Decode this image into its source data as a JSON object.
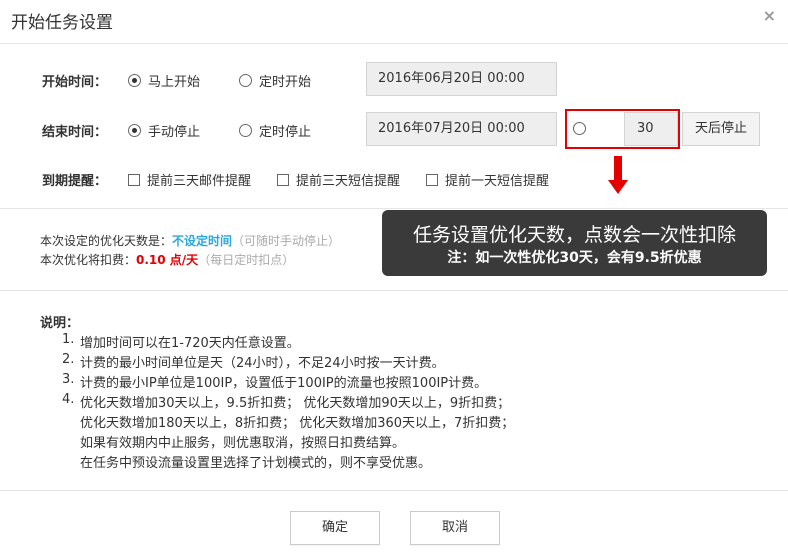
{
  "dialog": {
    "title": "开始任务设置",
    "close": "×"
  },
  "start": {
    "label": "开始时间：",
    "options": [
      "马上开始",
      "定时开始"
    ],
    "selected": 0,
    "datetime": "2016年06月20日 00:00"
  },
  "end": {
    "label": "结束时间：",
    "options": [
      "手动停止",
      "定时停止"
    ],
    "selected": 0,
    "datetime": "2016年07月20日 00:00",
    "days_value": "30",
    "days_suffix": "天后停止"
  },
  "reminder": {
    "label": "到期提醒：",
    "options": [
      "提前三天邮件提醒",
      "提前三天短信提醒",
      "提前一天短信提醒"
    ]
  },
  "summary": {
    "days_prefix": "本次设定的优化天数是：",
    "days_value": "不设定时间",
    "days_hint": "（可随时手动停止）",
    "fee_prefix": "本次优化将扣费：",
    "fee_value": "0.10 点/天",
    "fee_hint": "（每日定时扣点）"
  },
  "tooltip": {
    "line1": "任务设置优化天数，点数会一次性扣除",
    "line2": "注：如一次性优化30天，会有9.5折优惠"
  },
  "notes": {
    "title": "说明：",
    "items": [
      {
        "num": "1.",
        "lines": [
          "增加时间可以在1-720天内任意设置。"
        ]
      },
      {
        "num": "2.",
        "lines": [
          "计费的最小时间单位是天（24小时），不足24小时按一天计费。"
        ]
      },
      {
        "num": "3.",
        "lines": [
          "计费的最小IP单位是100IP，设置低于100IP的流量也按照100IP计费。"
        ]
      },
      {
        "num": "4.",
        "lines": [
          "优化天数增加30天以上，9.5折扣费； 优化天数增加90天以上，9折扣费；",
          "优化天数增加180天以上，8折扣费； 优化天数增加360天以上，7折扣费；",
          "如果有效期内中止服务，则优惠取消，按照日扣费结算。",
          "在任务中预设流量设置里选择了计划模式的，则不享受优惠。"
        ]
      }
    ]
  },
  "buttons": {
    "confirm": "确定",
    "cancel": "取消"
  },
  "colors": {
    "accent_blue": "#29a7e1",
    "accent_red": "#e20000",
    "tooltip_bg": "#3a3a3a"
  }
}
